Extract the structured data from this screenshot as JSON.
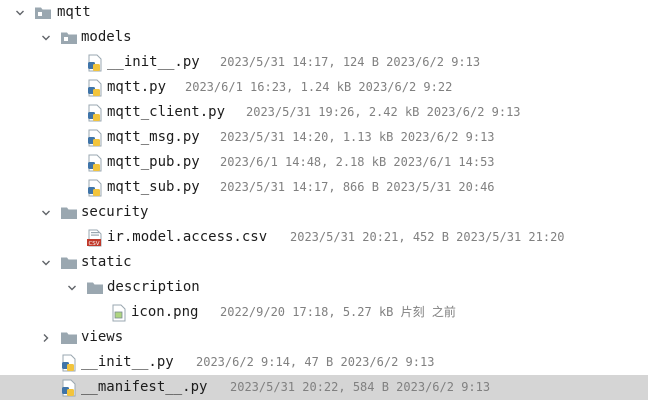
{
  "tree": {
    "rows": [
      {
        "name": "mqtt",
        "kind": "folder",
        "expanded": true,
        "icon": "package-folder-icon",
        "meta": ""
      },
      {
        "name": "models",
        "kind": "folder",
        "expanded": true,
        "icon": "package-folder-icon",
        "meta": ""
      },
      {
        "name": "__init__.py",
        "kind": "python-file",
        "icon": "python-file-icon",
        "meta": "2023/5/31 14:17, 124 B 2023/6/2 9:13"
      },
      {
        "name": "mqtt.py",
        "kind": "python-file",
        "icon": "python-file-icon",
        "meta": "2023/6/1 16:23, 1.24 kB 2023/6/2 9:22"
      },
      {
        "name": "mqtt_client.py",
        "kind": "python-file",
        "icon": "python-file-icon",
        "meta": "2023/5/31 19:26, 2.42 kB 2023/6/2 9:13"
      },
      {
        "name": "mqtt_msg.py",
        "kind": "python-file",
        "icon": "python-file-icon",
        "meta": "2023/5/31 14:20, 1.13 kB 2023/6/2 9:13"
      },
      {
        "name": "mqtt_pub.py",
        "kind": "python-file",
        "icon": "python-file-icon",
        "meta": "2023/6/1 14:48, 2.18 kB 2023/6/1 14:53"
      },
      {
        "name": "mqtt_sub.py",
        "kind": "python-file",
        "icon": "python-file-icon",
        "meta": "2023/5/31 14:17, 866 B 2023/5/31 20:46"
      },
      {
        "name": "security",
        "kind": "folder",
        "expanded": true,
        "icon": "folder-icon",
        "meta": ""
      },
      {
        "name": "ir.model.access.csv",
        "kind": "csv-file",
        "icon": "csv-file-icon",
        "meta": "2023/5/31 20:21, 452 B 2023/5/31 21:20"
      },
      {
        "name": "static",
        "kind": "folder",
        "expanded": true,
        "icon": "folder-icon",
        "meta": ""
      },
      {
        "name": "description",
        "kind": "folder",
        "expanded": true,
        "icon": "folder-icon",
        "meta": ""
      },
      {
        "name": "icon.png",
        "kind": "image-file",
        "icon": "image-file-icon",
        "meta": "2022/9/20 17:18, 5.27 kB 片刻 之前"
      },
      {
        "name": "views",
        "kind": "folder",
        "expanded": false,
        "icon": "folder-icon",
        "meta": ""
      },
      {
        "name": "__init__.py",
        "kind": "python-file",
        "icon": "python-file-icon",
        "meta": "2023/6/2 9:14, 47 B 2023/6/2 9:13"
      },
      {
        "name": "__manifest__.py",
        "kind": "python-file",
        "icon": "python-file-icon",
        "selected": true,
        "meta": "2023/5/31 20:22, 584 B 2023/6/2 9:13"
      }
    ]
  },
  "colors": {
    "selection": "#d5d5d5",
    "text": "#1c1c1c",
    "meta_text": "#808080",
    "folder": "#9aa7b0",
    "python_blue": "#3f74a8",
    "python_yellow": "#f2c43d"
  }
}
